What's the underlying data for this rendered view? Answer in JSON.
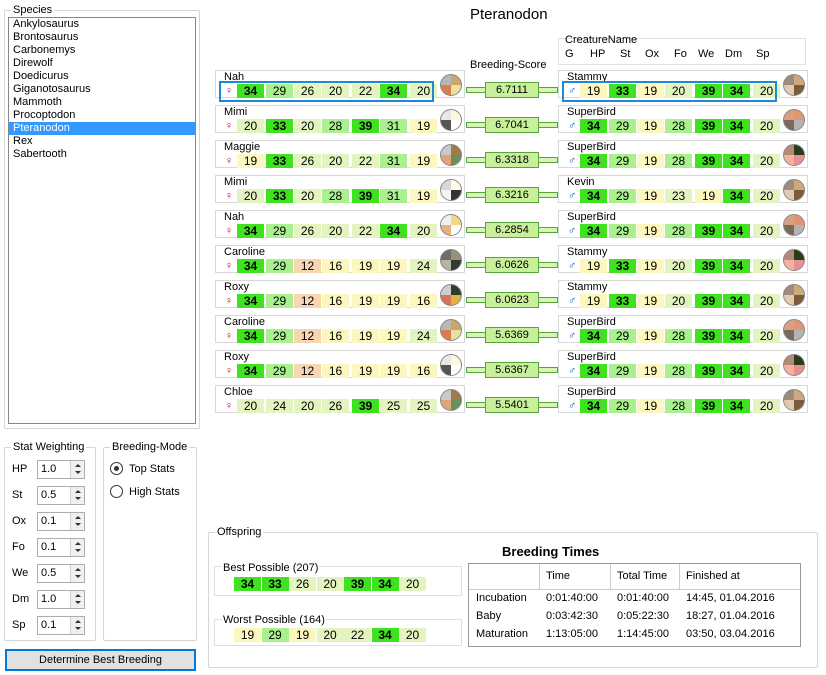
{
  "species": {
    "legend": "Species",
    "items": [
      "Ankylosaurus",
      "Brontosaurus",
      "Carbonemys",
      "Direwolf",
      "Doedicurus",
      "Giganotosaurus",
      "Mammoth",
      "Procoptodon",
      "Pteranodon",
      "Rex",
      "Sabertooth"
    ],
    "selected": "Pteranodon"
  },
  "title": "Pteranodon",
  "breeding_score_label": "Breeding-Score",
  "right_header": {
    "creature_name": "CreatureName",
    "columns": [
      "G",
      "HP",
      "St",
      "Ox",
      "Fo",
      "We",
      "Dm",
      "Sp"
    ]
  },
  "colors": {
    "best": "#3fe21f",
    "good": "#aaf08e",
    "mid": "#e3f4c0",
    "low": "#fcf6bf",
    "bad": "#f8d6b2",
    "selection": "#1e8ad6"
  },
  "pairs": [
    {
      "female": {
        "name": "Nah",
        "sex": "♀",
        "stats": [
          34,
          29,
          26,
          20,
          22,
          34,
          20
        ]
      },
      "score": "6.7111",
      "male": {
        "name": "Stammy",
        "sex": "♂",
        "stats": [
          19,
          33,
          19,
          20,
          39,
          34,
          20
        ]
      }
    },
    {
      "female": {
        "name": "Mimi",
        "sex": "♀",
        "stats": [
          20,
          33,
          20,
          28,
          39,
          31,
          19
        ]
      },
      "score": "6.7041",
      "male": {
        "name": "SuperBird",
        "sex": "♂",
        "stats": [
          34,
          29,
          19,
          28,
          39,
          34,
          20
        ]
      }
    },
    {
      "female": {
        "name": "Maggie",
        "sex": "♀",
        "stats": [
          19,
          33,
          26,
          20,
          22,
          31,
          19
        ]
      },
      "score": "6.3318",
      "male": {
        "name": "SuperBird",
        "sex": "♂",
        "stats": [
          34,
          29,
          19,
          28,
          39,
          34,
          20
        ]
      }
    },
    {
      "female": {
        "name": "Mimi",
        "sex": "♀",
        "stats": [
          20,
          33,
          20,
          28,
          39,
          31,
          19
        ]
      },
      "score": "6.3216",
      "male": {
        "name": "Kevin",
        "sex": "♂",
        "stats": [
          34,
          29,
          19,
          23,
          19,
          34,
          20
        ]
      }
    },
    {
      "female": {
        "name": "Nah",
        "sex": "♀",
        "stats": [
          34,
          29,
          26,
          20,
          22,
          34,
          20
        ]
      },
      "score": "6.2854",
      "male": {
        "name": "SuperBird",
        "sex": "♂",
        "stats": [
          34,
          29,
          19,
          28,
          39,
          34,
          20
        ]
      }
    },
    {
      "female": {
        "name": "Caroline",
        "sex": "♀",
        "stats": [
          34,
          29,
          12,
          16,
          19,
          19,
          24
        ]
      },
      "score": "6.0626",
      "male": {
        "name": "Stammy",
        "sex": "♂",
        "stats": [
          19,
          33,
          19,
          20,
          39,
          34,
          20
        ]
      }
    },
    {
      "female": {
        "name": "Roxy",
        "sex": "♀",
        "stats": [
          34,
          29,
          12,
          16,
          19,
          19,
          16
        ]
      },
      "score": "6.0623",
      "male": {
        "name": "Stammy",
        "sex": "♂",
        "stats": [
          19,
          33,
          19,
          20,
          39,
          34,
          20
        ]
      }
    },
    {
      "female": {
        "name": "Caroline",
        "sex": "♀",
        "stats": [
          34,
          29,
          12,
          16,
          19,
          19,
          24
        ]
      },
      "score": "5.6369",
      "male": {
        "name": "SuperBird",
        "sex": "♂",
        "stats": [
          34,
          29,
          19,
          28,
          39,
          34,
          20
        ]
      }
    },
    {
      "female": {
        "name": "Roxy",
        "sex": "♀",
        "stats": [
          34,
          29,
          12,
          16,
          19,
          19,
          16
        ]
      },
      "score": "5.6367",
      "male": {
        "name": "SuperBird",
        "sex": "♂",
        "stats": [
          34,
          29,
          19,
          28,
          39,
          34,
          20
        ]
      }
    },
    {
      "female": {
        "name": "Chloe",
        "sex": "♀",
        "stats": [
          20,
          24,
          20,
          26,
          39,
          25,
          25
        ]
      },
      "score": "5.5401",
      "male": {
        "name": "SuperBird",
        "sex": "♂",
        "stats": [
          34,
          29,
          19,
          28,
          39,
          34,
          20
        ]
      }
    }
  ],
  "stat_weighting": {
    "legend": "Stat Weighting",
    "rows": [
      {
        "label": "HP",
        "value": "1.0"
      },
      {
        "label": "St",
        "value": "0.5"
      },
      {
        "label": "Ox",
        "value": "0.1"
      },
      {
        "label": "Fo",
        "value": "0.1"
      },
      {
        "label": "We",
        "value": "0.5"
      },
      {
        "label": "Dm",
        "value": "1.0"
      },
      {
        "label": "Sp",
        "value": "0.1"
      }
    ]
  },
  "breeding_mode": {
    "legend": "Breeding-Mode",
    "options": [
      {
        "label": "Top Stats",
        "checked": true
      },
      {
        "label": "High Stats",
        "checked": false
      }
    ]
  },
  "determine_button": "Determine Best Breeding",
  "offspring": {
    "legend": "Offspring",
    "best": {
      "label": "Best Possible (207)",
      "stats": [
        34,
        33,
        26,
        20,
        39,
        34,
        20
      ]
    },
    "worst": {
      "label": "Worst Possible (164)",
      "stats": [
        19,
        29,
        19,
        20,
        22,
        34,
        20
      ]
    }
  },
  "breeding_times": {
    "title": "Breeding Times",
    "headers": [
      "Time",
      "Total Time",
      "Finished at"
    ],
    "rows": [
      {
        "label": "Incubation",
        "time": "0:01:40:00",
        "total": "0:01:40:00",
        "finished": "14:45, 01.04.2016"
      },
      {
        "label": "Baby",
        "time": "0:03:42:30",
        "total": "0:05:22:30",
        "finished": "18:27, 01.04.2016"
      },
      {
        "label": "Maturation",
        "time": "1:13:05:00",
        "total": "1:14:45:00",
        "finished": "03:50, 03.04.2016"
      }
    ]
  }
}
